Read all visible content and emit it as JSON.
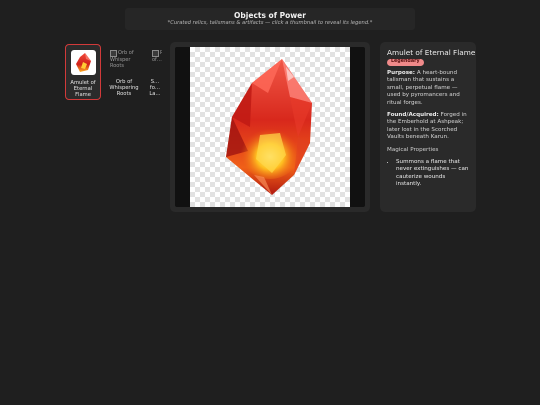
{
  "header": {
    "title": "Objects of Power",
    "subtitle": "*Curated relics, talismans & artifacts — click a thumbnail to reveal its legend.*"
  },
  "thumbnails": [
    {
      "label": "Amulet of Eternal Flame",
      "alt": ""
    },
    {
      "label": "Orb of Whispering Roots",
      "alt": "Orb of Whisper Roots"
    },
    {
      "label": "S… fo… La…",
      "alt": "Po… of…"
    }
  ],
  "legend": {
    "title": "Amulet of Eternal Flame",
    "rarity": "Legendary",
    "purpose_label": "Purpose:",
    "purpose_text": "A heart-bound talisman that sustains a small, perpetual flame — used by pyromancers and ritual forges.",
    "found_label": "Found/Acquired:",
    "found_text": "Forged in the Emberhold at Ashpeak; later lost in the Scorched Vaults beneath Karun.",
    "properties_title": "Magical Properties",
    "properties": [
      "Summons a flame that never extinguishes — can cauterize wounds instantly."
    ]
  },
  "colors": {
    "accent_selected_border": "#d23a3a",
    "rarity_badge": "#f08a8a",
    "gem": "#e0301e"
  },
  "icons": {
    "gem": "fire-gem-icon",
    "broken_image": "broken-image-icon"
  }
}
